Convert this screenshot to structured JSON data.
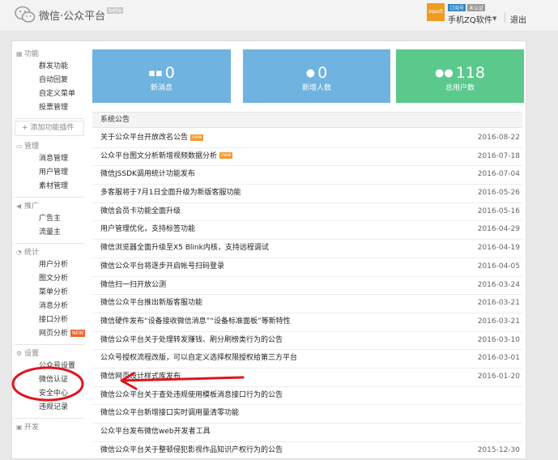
{
  "header": {
    "brand": "微信·公众平台",
    "brand_tag": "beta",
    "account": {
      "avatar_text": "zqsoft",
      "badges": [
        "订阅号",
        "未认证"
      ],
      "name": "手机ZQ软件",
      "logout": "退出"
    }
  },
  "sidebar": {
    "sections": [
      {
        "title": "功能",
        "icon": "grid-icon",
        "items": [
          {
            "label": "群发功能"
          },
          {
            "label": "自动回复"
          },
          {
            "label": "自定义菜单"
          },
          {
            "label": "投票管理"
          }
        ]
      },
      {
        "title": "管理",
        "icon": "chat-icon",
        "items": [
          {
            "label": "消息管理"
          },
          {
            "label": "用户管理"
          },
          {
            "label": "素材管理"
          }
        ]
      },
      {
        "title": "推广",
        "icon": "megaphone-icon",
        "items": [
          {
            "label": "广告主"
          },
          {
            "label": "流量主"
          }
        ]
      },
      {
        "title": "统计",
        "icon": "chart-icon",
        "items": [
          {
            "label": "用户分析"
          },
          {
            "label": "图文分析"
          },
          {
            "label": "菜单分析"
          },
          {
            "label": "消息分析"
          },
          {
            "label": "接口分析"
          },
          {
            "label": "网页分析",
            "tag": "NEW"
          }
        ]
      },
      {
        "title": "设置",
        "icon": "gear-icon",
        "items": [
          {
            "label": "公众号设置"
          },
          {
            "label": "微信认证"
          },
          {
            "label": "安全中心"
          },
          {
            "label": "违规记录"
          }
        ]
      },
      {
        "title": "开发",
        "icon": "code-icon",
        "items": []
      }
    ],
    "add_plugin": "+ 添加功能插件"
  },
  "stats": [
    {
      "value": "0",
      "label": "新消息",
      "icon": "message-icon",
      "color": "#6fb3e0"
    },
    {
      "value": "0",
      "label": "新增人数",
      "icon": "person-icon",
      "color": "#6fb3e0"
    },
    {
      "value": "118",
      "label": "总用户数",
      "icon": "users-icon",
      "color": "#5bc98c"
    }
  ],
  "announcements": {
    "header": "系统公告",
    "items": [
      {
        "title": "关于公众平台开放改名公告",
        "date": "2016-08-22",
        "hot": true
      },
      {
        "title": "公众平台图文分析新增视频数据分析",
        "date": "2016-07-18",
        "hot": true
      },
      {
        "title": "微信JSSDK调用统计功能发布",
        "date": "2016-07-04"
      },
      {
        "title": "多客服将于7月1日全面升级为新版客服功能",
        "date": "2016-05-26"
      },
      {
        "title": "微信会员卡功能全面升级",
        "date": "2016-05-16"
      },
      {
        "title": "用户管理优化，支持标签功能",
        "date": "2016-04-29"
      },
      {
        "title": "微信浏览器全面升级至X5 Blink内核，支持远程调试",
        "date": "2016-04-19"
      },
      {
        "title": "微信公众平台将逐步开启帐号扫码登录",
        "date": "2016-04-05"
      },
      {
        "title": "微信扫一扫开放公测",
        "date": "2016-03-24"
      },
      {
        "title": "微信公众平台推出新版客服功能",
        "date": "2016-03-21"
      },
      {
        "title": "微信硬件发布“设备接收微信消息”“设备标准面板”等新特性",
        "date": "2016-03-21"
      },
      {
        "title": "微信公众平台关于处理转发赚钱、刷分刷榜类行为的公告",
        "date": "2016-03-10"
      },
      {
        "title": "公众号授权流程改版，可以自定义选择权限授权给第三方平台",
        "date": "2016-03-01"
      },
      {
        "title": "微信网页设计样式库发布",
        "date": "2016-01-20"
      },
      {
        "title": "微信公众平台关于查处违规使用模板消息接口行为的公告",
        "date": ""
      },
      {
        "title": "微信公众平台新增接口实时调用量清零功能",
        "date": ""
      },
      {
        "title": "公众平台发布微信web开发者工具",
        "date": ""
      },
      {
        "title": "微信公众平台关于整顿侵犯影视作品知识产权行为的公告",
        "date": "2015-12-30"
      }
    ]
  },
  "annotation_color": "#e0141e"
}
